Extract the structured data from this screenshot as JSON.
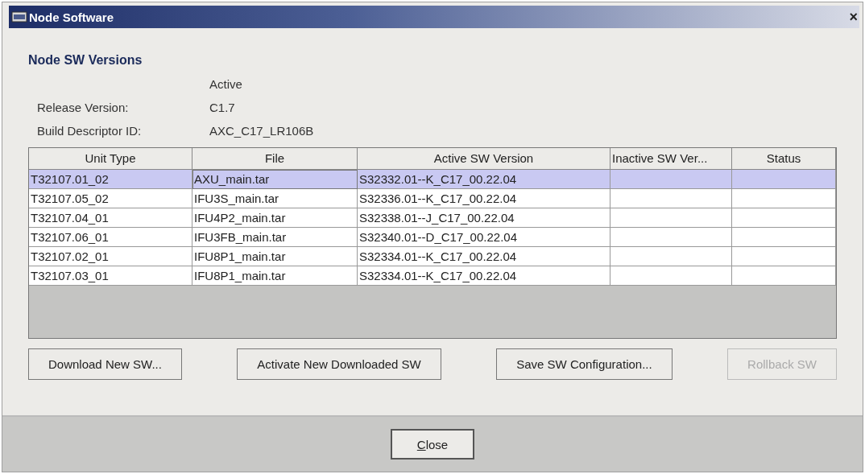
{
  "window": {
    "title": "Node Software",
    "close": "×"
  },
  "heading": "Node SW Versions",
  "info": {
    "column_header": "Active",
    "fields": [
      {
        "label": "Release Version:",
        "value": "C1.7"
      },
      {
        "label": "Build Descriptor ID:",
        "value": "AXC_C17_LR106B"
      }
    ]
  },
  "table": {
    "columns": [
      "Unit Type",
      "File",
      "Active SW Version",
      "Inactive SW Ver...",
      "Status"
    ],
    "rows": [
      {
        "cells": [
          "T32107.01_02",
          "AXU_main.tar",
          "S32332.01--K_C17_00.22.04",
          "",
          ""
        ],
        "selected": true
      },
      {
        "cells": [
          "T32107.05_02",
          "IFU3S_main.tar",
          "S32336.01--K_C17_00.22.04",
          "",
          ""
        ],
        "selected": false
      },
      {
        "cells": [
          "T32107.04_01",
          "IFU4P2_main.tar",
          "S32338.01--J_C17_00.22.04",
          "",
          ""
        ],
        "selected": false
      },
      {
        "cells": [
          "T32107.06_01",
          "IFU3FB_main.tar",
          "S32340.01--D_C17_00.22.04",
          "",
          ""
        ],
        "selected": false
      },
      {
        "cells": [
          "T32107.02_01",
          "IFU8P1_main.tar",
          "S32334.01--K_C17_00.22.04",
          "",
          ""
        ],
        "selected": false
      },
      {
        "cells": [
          "T32107.03_01",
          "IFU8P1_main.tar",
          "S32334.01--K_C17_00.22.04",
          "",
          ""
        ],
        "selected": false
      }
    ]
  },
  "buttons": [
    {
      "label": "Download New SW...",
      "disabled": false
    },
    {
      "label": "Activate New Downloaded SW",
      "disabled": false
    },
    {
      "label": "Save SW Configuration...",
      "disabled": false
    },
    {
      "label": "Rollback SW",
      "disabled": true
    }
  ],
  "footer_button": {
    "label": "Close",
    "mnemonic_underlined": true
  }
}
